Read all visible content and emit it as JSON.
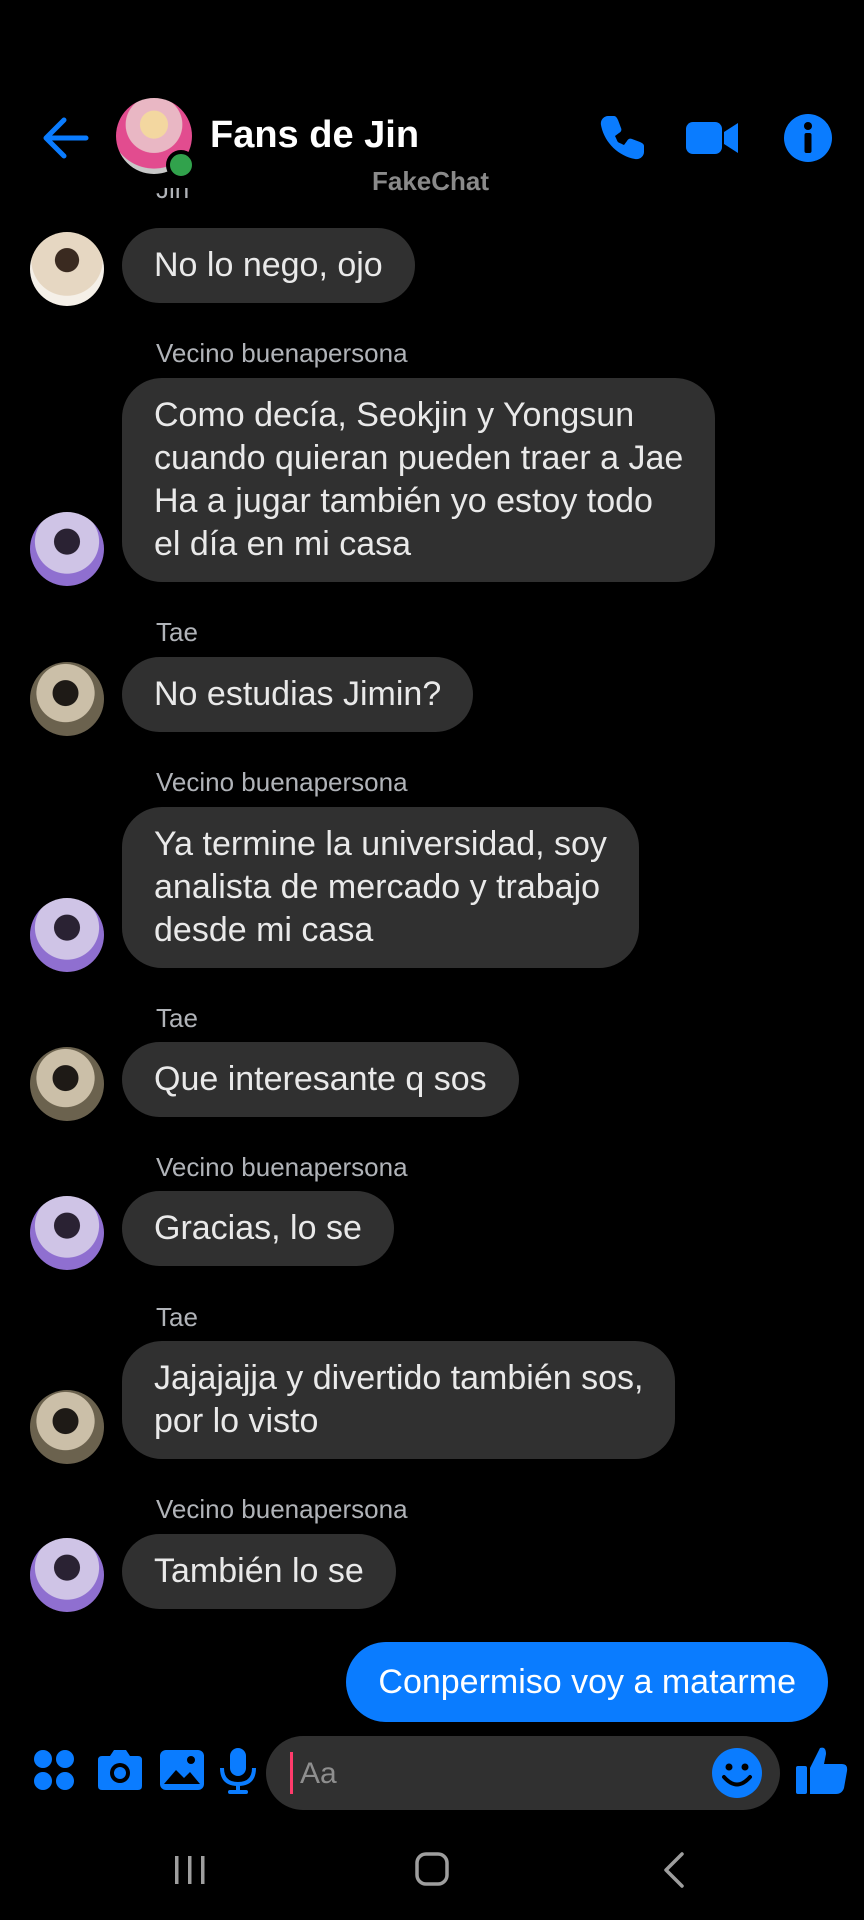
{
  "header": {
    "title": "Fans de Jin",
    "watermark": "FakeChat",
    "cut_off_sender": "Jin"
  },
  "messages": [
    {
      "sender": "",
      "text": "No lo nego, ojo",
      "avatar": "jin"
    },
    {
      "sender": "Vecino buenapersona",
      "text": "Como decía, Seokjin y Yongsun\ncuando quieran pueden traer a Jae\nHa a jugar también yo estoy todo\nel día en mi casa",
      "avatar": "vecino"
    },
    {
      "sender": "Tae",
      "text": "No estudias Jimin?",
      "avatar": "tae"
    },
    {
      "sender": "Vecino buenapersona",
      "text": "Ya termine la universidad, soy\nanalista de mercado y trabajo\ndesde mi casa",
      "avatar": "vecino"
    },
    {
      "sender": "Tae",
      "text": "Que interesante q sos",
      "avatar": "tae"
    },
    {
      "sender": "Vecino buenapersona",
      "text": "Gracias, lo se",
      "avatar": "vecino"
    },
    {
      "sender": "Tae",
      "text": "Jajajajja y divertido también sos,\npor lo visto",
      "avatar": "tae"
    },
    {
      "sender": "Vecino buenapersona",
      "text": "También lo se",
      "avatar": "vecino"
    }
  ],
  "my_message": {
    "text": "Conpermiso voy a matarme"
  },
  "composer": {
    "placeholder": "Aa"
  },
  "colors": {
    "accent": "#0a7cff",
    "bubble": "#303030",
    "background": "#000000",
    "online": "#31a24c"
  }
}
